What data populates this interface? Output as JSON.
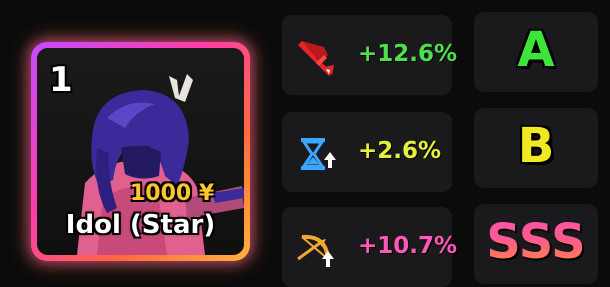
{
  "unit_card": {
    "slot_number": "1",
    "price": "1000 ¥",
    "name": "Idol (Star)",
    "border_colors": [
      "#c44bff",
      "#ff3da8",
      "#ff6a3d",
      "#ffb23d"
    ]
  },
  "stats": [
    {
      "icon": "damage-sword-icon",
      "value": "+12.6%",
      "color": "#4ee04a"
    },
    {
      "icon": "cooldown-hourglass-icon",
      "value": "+2.6%",
      "color": "#e6ef3c"
    },
    {
      "icon": "range-bow-icon",
      "value": "+10.7%",
      "color": "#ff58b8"
    }
  ],
  "grades": [
    {
      "value": "A",
      "color": "#3fe43a"
    },
    {
      "value": "B",
      "color": "#f2ea21"
    },
    {
      "value": "SSS",
      "color": "#ff4fb0"
    }
  ]
}
